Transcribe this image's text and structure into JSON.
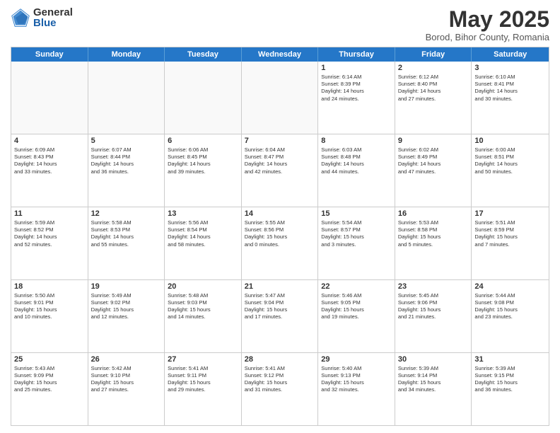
{
  "logo": {
    "general": "General",
    "blue": "Blue"
  },
  "title": "May 2025",
  "subtitle": "Borod, Bihor County, Romania",
  "days": [
    "Sunday",
    "Monday",
    "Tuesday",
    "Wednesday",
    "Thursday",
    "Friday",
    "Saturday"
  ],
  "rows": [
    [
      {
        "day": "",
        "text": "",
        "empty": true
      },
      {
        "day": "",
        "text": "",
        "empty": true
      },
      {
        "day": "",
        "text": "",
        "empty": true
      },
      {
        "day": "",
        "text": "",
        "empty": true
      },
      {
        "day": "1",
        "text": "Sunrise: 6:14 AM\nSunset: 8:39 PM\nDaylight: 14 hours\nand 24 minutes."
      },
      {
        "day": "2",
        "text": "Sunrise: 6:12 AM\nSunset: 8:40 PM\nDaylight: 14 hours\nand 27 minutes."
      },
      {
        "day": "3",
        "text": "Sunrise: 6:10 AM\nSunset: 8:41 PM\nDaylight: 14 hours\nand 30 minutes."
      }
    ],
    [
      {
        "day": "4",
        "text": "Sunrise: 6:09 AM\nSunset: 8:43 PM\nDaylight: 14 hours\nand 33 minutes."
      },
      {
        "day": "5",
        "text": "Sunrise: 6:07 AM\nSunset: 8:44 PM\nDaylight: 14 hours\nand 36 minutes."
      },
      {
        "day": "6",
        "text": "Sunrise: 6:06 AM\nSunset: 8:45 PM\nDaylight: 14 hours\nand 39 minutes."
      },
      {
        "day": "7",
        "text": "Sunrise: 6:04 AM\nSunset: 8:47 PM\nDaylight: 14 hours\nand 42 minutes."
      },
      {
        "day": "8",
        "text": "Sunrise: 6:03 AM\nSunset: 8:48 PM\nDaylight: 14 hours\nand 44 minutes."
      },
      {
        "day": "9",
        "text": "Sunrise: 6:02 AM\nSunset: 8:49 PM\nDaylight: 14 hours\nand 47 minutes."
      },
      {
        "day": "10",
        "text": "Sunrise: 6:00 AM\nSunset: 8:51 PM\nDaylight: 14 hours\nand 50 minutes."
      }
    ],
    [
      {
        "day": "11",
        "text": "Sunrise: 5:59 AM\nSunset: 8:52 PM\nDaylight: 14 hours\nand 52 minutes."
      },
      {
        "day": "12",
        "text": "Sunrise: 5:58 AM\nSunset: 8:53 PM\nDaylight: 14 hours\nand 55 minutes."
      },
      {
        "day": "13",
        "text": "Sunrise: 5:56 AM\nSunset: 8:54 PM\nDaylight: 14 hours\nand 58 minutes."
      },
      {
        "day": "14",
        "text": "Sunrise: 5:55 AM\nSunset: 8:56 PM\nDaylight: 15 hours\nand 0 minutes."
      },
      {
        "day": "15",
        "text": "Sunrise: 5:54 AM\nSunset: 8:57 PM\nDaylight: 15 hours\nand 3 minutes."
      },
      {
        "day": "16",
        "text": "Sunrise: 5:53 AM\nSunset: 8:58 PM\nDaylight: 15 hours\nand 5 minutes."
      },
      {
        "day": "17",
        "text": "Sunrise: 5:51 AM\nSunset: 8:59 PM\nDaylight: 15 hours\nand 7 minutes."
      }
    ],
    [
      {
        "day": "18",
        "text": "Sunrise: 5:50 AM\nSunset: 9:01 PM\nDaylight: 15 hours\nand 10 minutes."
      },
      {
        "day": "19",
        "text": "Sunrise: 5:49 AM\nSunset: 9:02 PM\nDaylight: 15 hours\nand 12 minutes."
      },
      {
        "day": "20",
        "text": "Sunrise: 5:48 AM\nSunset: 9:03 PM\nDaylight: 15 hours\nand 14 minutes."
      },
      {
        "day": "21",
        "text": "Sunrise: 5:47 AM\nSunset: 9:04 PM\nDaylight: 15 hours\nand 17 minutes."
      },
      {
        "day": "22",
        "text": "Sunrise: 5:46 AM\nSunset: 9:05 PM\nDaylight: 15 hours\nand 19 minutes."
      },
      {
        "day": "23",
        "text": "Sunrise: 5:45 AM\nSunset: 9:06 PM\nDaylight: 15 hours\nand 21 minutes."
      },
      {
        "day": "24",
        "text": "Sunrise: 5:44 AM\nSunset: 9:08 PM\nDaylight: 15 hours\nand 23 minutes."
      }
    ],
    [
      {
        "day": "25",
        "text": "Sunrise: 5:43 AM\nSunset: 9:09 PM\nDaylight: 15 hours\nand 25 minutes."
      },
      {
        "day": "26",
        "text": "Sunrise: 5:42 AM\nSunset: 9:10 PM\nDaylight: 15 hours\nand 27 minutes."
      },
      {
        "day": "27",
        "text": "Sunrise: 5:41 AM\nSunset: 9:11 PM\nDaylight: 15 hours\nand 29 minutes."
      },
      {
        "day": "28",
        "text": "Sunrise: 5:41 AM\nSunset: 9:12 PM\nDaylight: 15 hours\nand 31 minutes."
      },
      {
        "day": "29",
        "text": "Sunrise: 5:40 AM\nSunset: 9:13 PM\nDaylight: 15 hours\nand 32 minutes."
      },
      {
        "day": "30",
        "text": "Sunrise: 5:39 AM\nSunset: 9:14 PM\nDaylight: 15 hours\nand 34 minutes."
      },
      {
        "day": "31",
        "text": "Sunrise: 5:39 AM\nSunset: 9:15 PM\nDaylight: 15 hours\nand 36 minutes."
      }
    ]
  ]
}
